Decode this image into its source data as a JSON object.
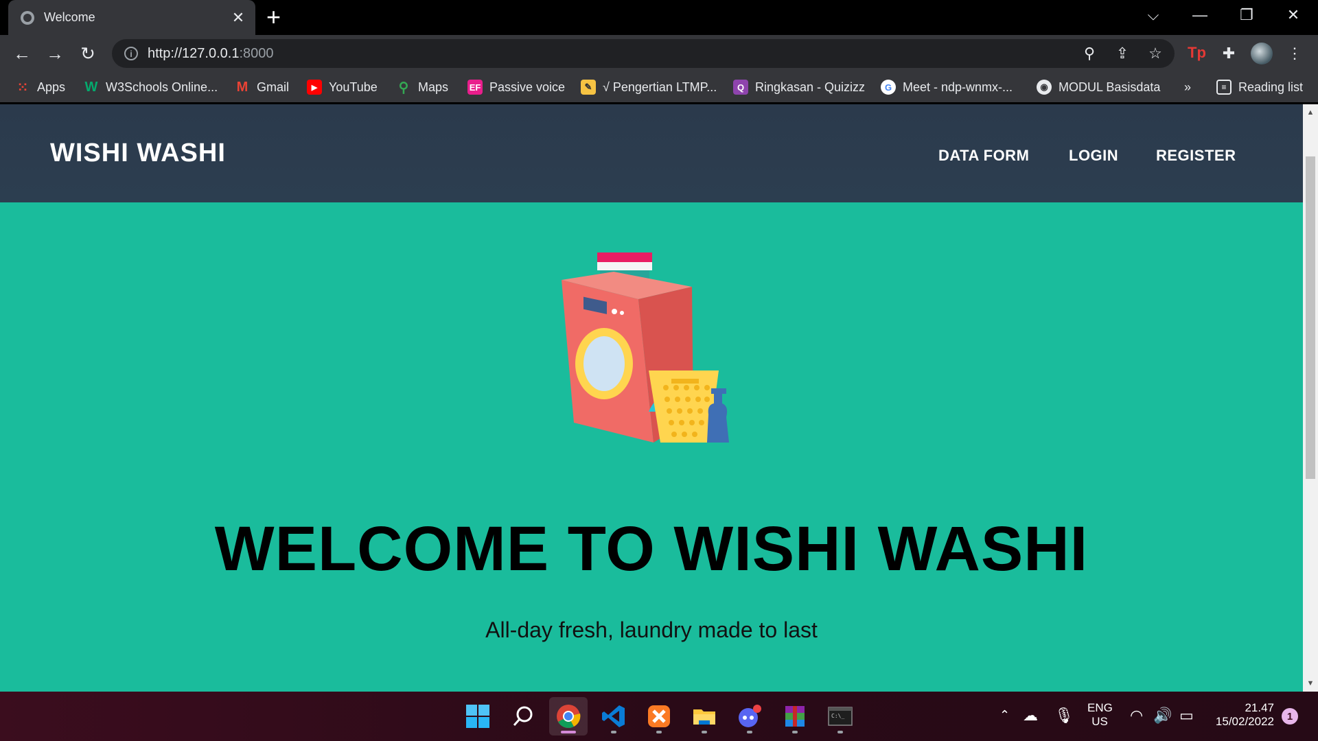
{
  "browser": {
    "tab_title": "Welcome",
    "close_tab": "✕",
    "new_tab": "+",
    "url_host": "http://127.0.0.1",
    "url_port": ":8000",
    "reading_list": "Reading list",
    "more_bookmarks": "»",
    "bookmarks": [
      {
        "label": "Apps",
        "icon": "apps-grid-icon"
      },
      {
        "label": "W3Schools Online...",
        "icon": "w3schools-icon"
      },
      {
        "label": "Gmail",
        "icon": "gmail-icon"
      },
      {
        "label": "YouTube",
        "icon": "youtube-icon"
      },
      {
        "label": "Maps",
        "icon": "maps-icon"
      },
      {
        "label": "Passive voice",
        "icon": "ef-icon"
      },
      {
        "label": "√ Pengertian LTMP...",
        "icon": "ltmp-icon"
      },
      {
        "label": "Ringkasan - Quizizz",
        "icon": "quizizz-icon"
      },
      {
        "label": "Meet - ndp-wnmx-...",
        "icon": "google-icon"
      },
      {
        "label": "MODUL Basisdata",
        "icon": "globe-icon"
      }
    ]
  },
  "site": {
    "brand": "WISHI WASHI",
    "nav": [
      "DATA FORM",
      "LOGIN",
      "REGISTER"
    ],
    "hero_title": "WELCOME TO WISHI WASHI",
    "hero_subtitle": "All-day fresh, laundry made to last",
    "colors": {
      "nav_bg": "#2c3e50",
      "hero_bg": "#1abc9c"
    }
  },
  "taskbar": {
    "lang_top": "ENG",
    "lang_bottom": "US",
    "time": "21.47",
    "date": "15/02/2022",
    "notifications": "1"
  }
}
